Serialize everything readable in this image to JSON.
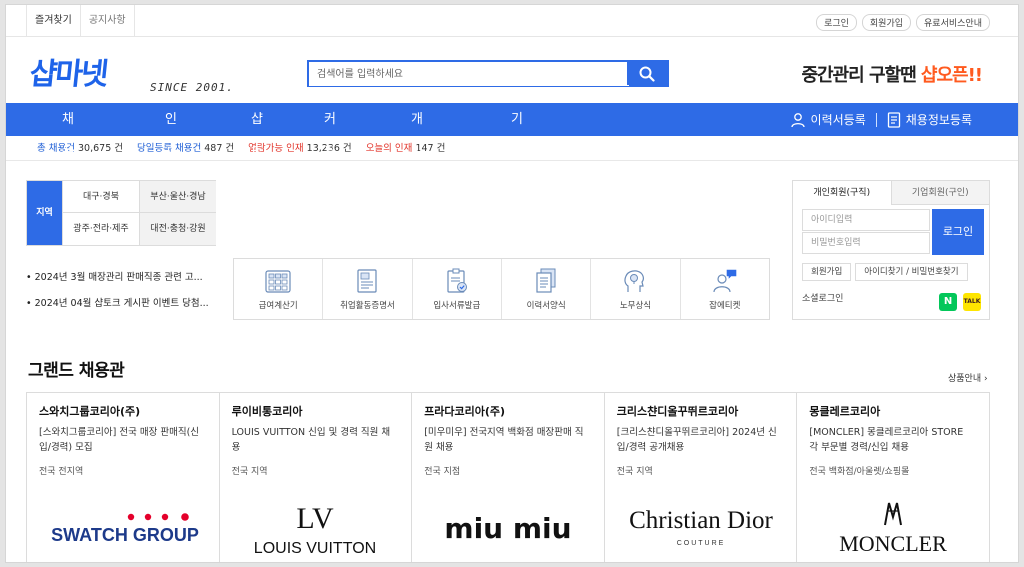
{
  "topbar": {
    "left": [
      "즐겨찾기",
      "공지사항"
    ],
    "right": [
      "로그인",
      "회원가입",
      "유료서비스안내"
    ]
  },
  "header": {
    "logo": "샵마넷",
    "since": "SINCE 2001.",
    "search_placeholder": "검색어를 입력하세요",
    "promo_text": "중간관리 구할땐 ",
    "promo_accent": "샵오픈!!"
  },
  "nav": {
    "items": [
      "채용정보",
      "인재검색",
      "샵토크",
      "커뮤니티",
      "개인서비스",
      "기업서비스"
    ],
    "resume_register": "이력서등록",
    "job_register": "채용정보등록"
  },
  "stats": [
    {
      "label": "총 채용건",
      "value": "30,675 건"
    },
    {
      "label": "당일등록 채용건",
      "value": "487 건"
    },
    {
      "label": "열람가능 인재",
      "value": "13,236 건"
    },
    {
      "label": "오늘의 인재",
      "value": "147 건"
    }
  ],
  "region": {
    "label": "지역",
    "cells": [
      "대구·경북",
      "부산·울산·경남",
      "광주·전라·제주",
      "대전·충청·강원"
    ]
  },
  "notices": [
    "• 2024년 3월 매장관리 판매직종 관련 고...",
    "• 2024년 04월 샵토크 게시판 이벤트 당첨..."
  ],
  "services": [
    {
      "label": "급여계산기",
      "icon": "calculator-icon"
    },
    {
      "label": "취업활동증명서",
      "icon": "certificate-icon"
    },
    {
      "label": "입사서류발급",
      "icon": "document-check-icon"
    },
    {
      "label": "이력서양식",
      "icon": "resume-stack-icon"
    },
    {
      "label": "노무상식",
      "icon": "head-lightbulb-icon"
    },
    {
      "label": "잡에티켓",
      "icon": "person-chat-icon"
    }
  ],
  "login": {
    "tab_personal": "개인회원(구직)",
    "tab_company": "기업회원(구인)",
    "id_placeholder": "아이디입력",
    "pw_placeholder": "비밀번호입력",
    "login_button": "로그인",
    "signup": "회원가입",
    "find": "아이디찾기 / 비밀번호찾기",
    "social_label": "소셜로그인",
    "naver": "N",
    "kakao": "TALK"
  },
  "grand": {
    "title": "그랜드 채용관",
    "more": "상품안내",
    "cards": [
      {
        "company": "스와치그룹코리아(주)",
        "desc": "[스와치그룹코리아] 전국 매장 판매직(신입/경력) 모집",
        "loc": "전국 전지역",
        "logo": "SWATCH GROUP"
      },
      {
        "company": "루이비통코리아",
        "desc": "LOUIS VUITTON 신입 및 경력 직원 채용",
        "loc": "전국 지역",
        "logo": "LOUIS VUITTON",
        "monogram": "LV"
      },
      {
        "company": "프라다코리아(주)",
        "desc": "[미우미우] 전국지역 백화점 매장판매 직원 채용",
        "loc": "전국 지점",
        "logo": "miu miu"
      },
      {
        "company": "크리스챤디올꾸뛰르코리아",
        "desc": "[크리스챤디올꾸뛰르코리아] 2024년 신입/경력 공개채용",
        "loc": "전국 지역",
        "logo": "Christian Dior",
        "logo_sub": "COUTURE"
      },
      {
        "company": "몽클레르코리아",
        "desc": "[MONCLER] 몽클레르코리아 STORE 각 부문별 경력/신입 채용",
        "loc": "전국 백화점/아울렛/쇼핑몰",
        "logo": "MONCLER"
      }
    ]
  },
  "colors": {
    "brand": "#2e6be6",
    "accent": "#ff5a1f",
    "stat_blue": "#1f5fd6",
    "stat_red": "#e2342a"
  }
}
